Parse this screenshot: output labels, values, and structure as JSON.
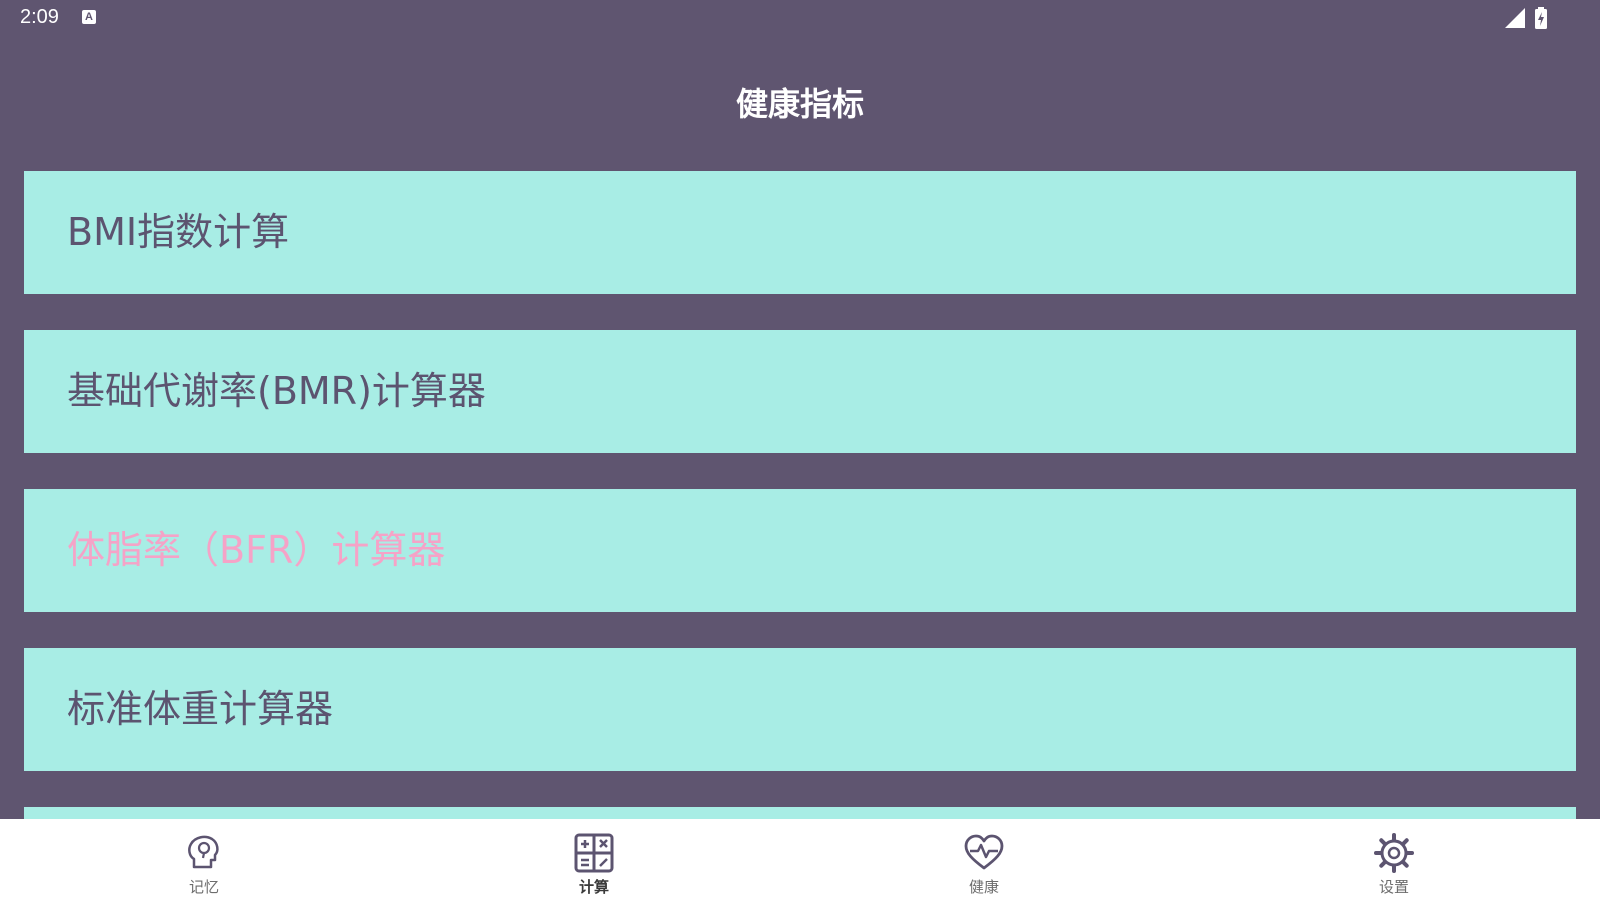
{
  "status_bar": {
    "time": "2:09",
    "notification_icon_letter": "A",
    "icons": [
      "signal-icon",
      "battery-icon"
    ]
  },
  "header": {
    "title": "健康指标"
  },
  "cards": [
    {
      "label": "BMI指数计算"
    },
    {
      "label": "基础代谢率(BMR)计算器"
    },
    {
      "label": "体脂率（BFR）计算器"
    },
    {
      "label": "标准体重计算器"
    }
  ],
  "bottom_nav": {
    "items": [
      {
        "label": "记忆",
        "icon": "brain-head-icon",
        "active": false
      },
      {
        "label": "计算",
        "icon": "calculator-icon",
        "active": true
      },
      {
        "label": "健康",
        "icon": "heart-pulse-icon",
        "active": false
      },
      {
        "label": "设置",
        "icon": "gear-icon",
        "active": false
      }
    ]
  },
  "colors": {
    "background": "#5f5570",
    "card": "#a8ede5",
    "card_text": "#5c5470",
    "highlight_text": "#f5a3c7",
    "nav_background": "#ffffff"
  }
}
